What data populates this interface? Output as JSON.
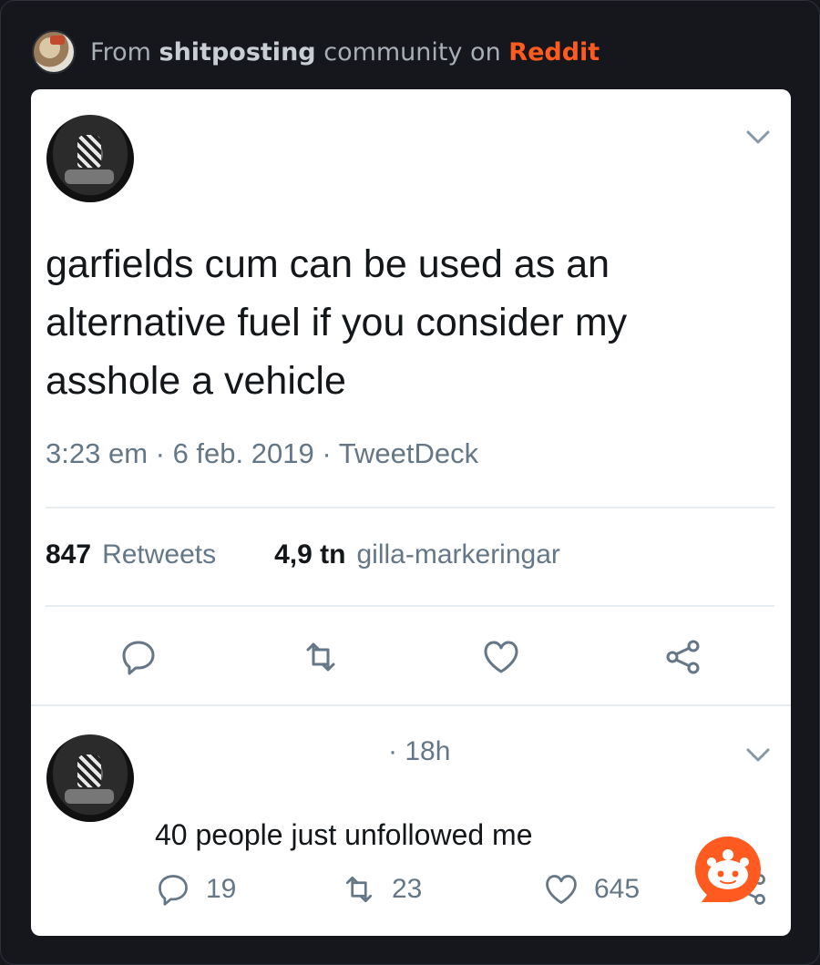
{
  "source": {
    "prefix": "From",
    "community": "shitposting",
    "middle": "community on",
    "platform": "Reddit"
  },
  "tweet": {
    "text": "garfields cum can be used as an alternative fuel if you consider my asshole a vehicle",
    "time": "3:23 em",
    "date": "6 feb. 2019",
    "client": "TweetDeck",
    "retweets_count": "847",
    "retweets_label": "Retweets",
    "likes_count": "4,9 tn",
    "likes_label": "gilla-markeringar"
  },
  "reply": {
    "time": "18h",
    "text": "40 people just unfollowed me",
    "replies": "19",
    "retweets": "23",
    "likes": "645"
  },
  "colors": {
    "background": "#15171c",
    "reddit_orange": "#ff5a1f",
    "text_primary": "#14171a",
    "text_secondary": "#657786"
  },
  "icons": [
    "reply-icon",
    "retweet-icon",
    "like-icon",
    "share-icon",
    "chevron-down-icon",
    "reddit-snoo-icon"
  ]
}
